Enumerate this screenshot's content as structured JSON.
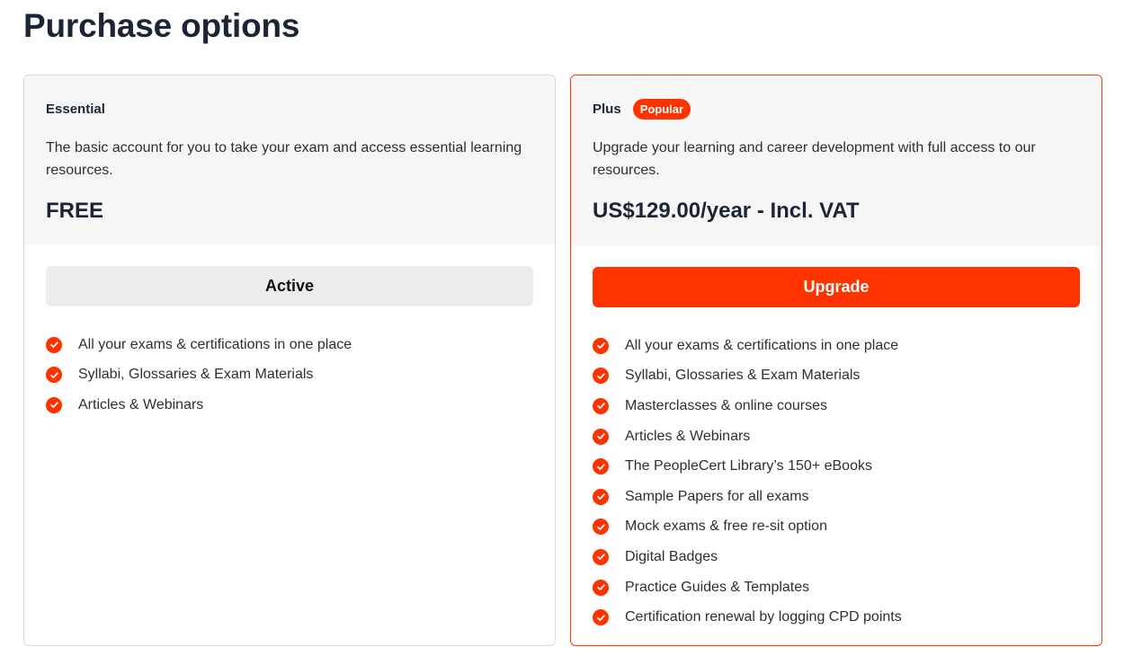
{
  "page": {
    "title": "Purchase options"
  },
  "plans": {
    "essential": {
      "name": "Essential",
      "description": "The basic account for you to take your exam and access essential learning resources.",
      "price": "FREE",
      "button_label": "Active",
      "features": [
        "All your exams & certifications in one place",
        "Syllabi, Glossaries & Exam Materials",
        "Articles & Webinars"
      ]
    },
    "plus": {
      "name": "Plus",
      "badge": "Popular",
      "description": "Upgrade your learning and career development with full access to our resources.",
      "price": "US$129.00/year - Incl. VAT",
      "button_label": "Upgrade",
      "features": [
        "All your exams & certifications in one place",
        "Syllabi, Glossaries & Exam Materials",
        "Masterclasses & online courses",
        "Articles & Webinars",
        "The PeopleCert Library’s 150+ eBooks",
        "Sample Papers for all exams",
        "Mock exams & free re-sit option",
        "Digital Badges",
        "Practice Guides & Templates",
        "Certification renewal by logging CPD points"
      ]
    }
  },
  "icons": {
    "feature": "check-circle-icon"
  },
  "colors": {
    "accent": "#ff3300",
    "heading": "#1b2536",
    "header_bg": "#f6f6f6"
  }
}
